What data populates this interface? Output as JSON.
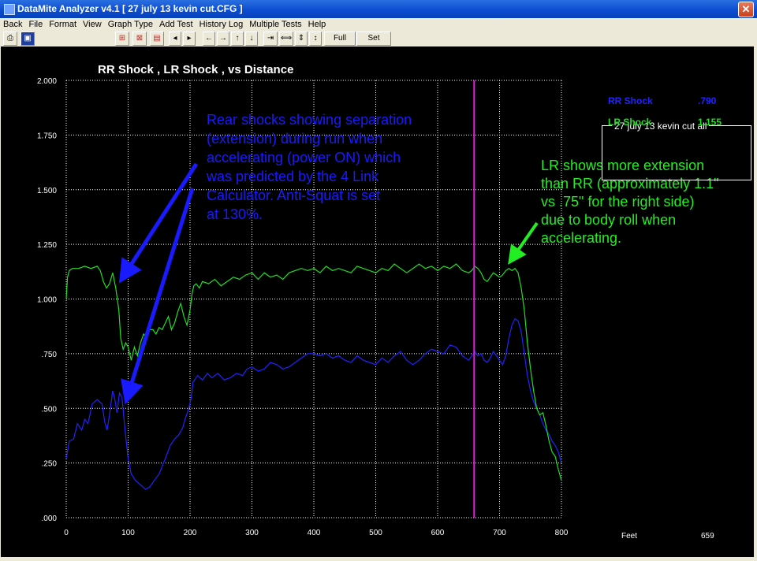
{
  "window": {
    "title": "DataMite Analyzer v4.1  [ 27 july 13 kevin cut.CFG ]",
    "close_glyph": "✕"
  },
  "menu": [
    "Back",
    "File",
    "Format",
    "View",
    "Graph Type",
    "Add Test",
    "History Log",
    "Multiple Tests",
    "Help"
  ],
  "toolbar": {
    "full_view_label": "Full View",
    "set_scales_label": "Set Scales"
  },
  "legend": {
    "title": "27 july 13 kevin cut   all",
    "items": [
      {
        "name": "RR Shock",
        "value": ".790",
        "color": "#2222ff"
      },
      {
        "name": "LR Shock",
        "value": "1.155",
        "color": "#22dd22"
      }
    ]
  },
  "cursor_readout": {
    "label": "Feet",
    "value": "659"
  },
  "chart_data": {
    "type": "line",
    "title": "RR Shock , LR Shock ,  vs Distance",
    "xlabel": "",
    "ylabel": "",
    "xlim": [
      0,
      800
    ],
    "ylim": [
      0,
      2.0
    ],
    "x_ticks": [
      "0",
      "100",
      "200",
      "300",
      "400",
      "500",
      "600",
      "700",
      "800"
    ],
    "y_ticks": [
      ".000",
      ".250",
      ".500",
      ".750",
      "1.000",
      "1.250",
      "1.500",
      "1.750",
      "2.000"
    ],
    "grid": true,
    "cursor_x": 659,
    "cursor_color": "#e020e0",
    "series": [
      {
        "name": "RR Shock",
        "color": "#2222ff",
        "points": [
          [
            0,
            0.27
          ],
          [
            5,
            0.35
          ],
          [
            12,
            0.36
          ],
          [
            18,
            0.43
          ],
          [
            25,
            0.4
          ],
          [
            30,
            0.45
          ],
          [
            35,
            0.43
          ],
          [
            42,
            0.52
          ],
          [
            50,
            0.54
          ],
          [
            58,
            0.52
          ],
          [
            62,
            0.44
          ],
          [
            66,
            0.4
          ],
          [
            70,
            0.47
          ],
          [
            75,
            0.58
          ],
          [
            78,
            0.55
          ],
          [
            82,
            0.48
          ],
          [
            86,
            0.57
          ],
          [
            90,
            0.55
          ],
          [
            95,
            0.4
          ],
          [
            100,
            0.27
          ],
          [
            105,
            0.2
          ],
          [
            112,
            0.17
          ],
          [
            120,
            0.15
          ],
          [
            128,
            0.13
          ],
          [
            135,
            0.14
          ],
          [
            142,
            0.17
          ],
          [
            150,
            0.2
          ],
          [
            160,
            0.27
          ],
          [
            168,
            0.33
          ],
          [
            175,
            0.36
          ],
          [
            182,
            0.38
          ],
          [
            188,
            0.41
          ],
          [
            192,
            0.45
          ],
          [
            198,
            0.5
          ],
          [
            202,
            0.55
          ],
          [
            205,
            0.62
          ],
          [
            212,
            0.65
          ],
          [
            220,
            0.63
          ],
          [
            228,
            0.66
          ],
          [
            235,
            0.64
          ],
          [
            245,
            0.66
          ],
          [
            255,
            0.63
          ],
          [
            265,
            0.64
          ],
          [
            275,
            0.66
          ],
          [
            285,
            0.65
          ],
          [
            292,
            0.68
          ],
          [
            300,
            0.69
          ],
          [
            310,
            0.67
          ],
          [
            320,
            0.68
          ],
          [
            330,
            0.71
          ],
          [
            340,
            0.7
          ],
          [
            350,
            0.68
          ],
          [
            360,
            0.69
          ],
          [
            370,
            0.71
          ],
          [
            380,
            0.73
          ],
          [
            390,
            0.75
          ],
          [
            400,
            0.75
          ],
          [
            410,
            0.74
          ],
          [
            420,
            0.75
          ],
          [
            430,
            0.73
          ],
          [
            440,
            0.74
          ],
          [
            450,
            0.72
          ],
          [
            460,
            0.71
          ],
          [
            470,
            0.74
          ],
          [
            480,
            0.72
          ],
          [
            490,
            0.71
          ],
          [
            500,
            0.7
          ],
          [
            510,
            0.73
          ],
          [
            520,
            0.71
          ],
          [
            530,
            0.74
          ],
          [
            540,
            0.76
          ],
          [
            550,
            0.72
          ],
          [
            560,
            0.7
          ],
          [
            570,
            0.72
          ],
          [
            580,
            0.75
          ],
          [
            590,
            0.77
          ],
          [
            600,
            0.76
          ],
          [
            610,
            0.75
          ],
          [
            620,
            0.79
          ],
          [
            630,
            0.78
          ],
          [
            640,
            0.74
          ],
          [
            650,
            0.72
          ],
          [
            655,
            0.74
          ],
          [
            660,
            0.76
          ],
          [
            665,
            0.74
          ],
          [
            670,
            0.75
          ],
          [
            675,
            0.72
          ],
          [
            680,
            0.71
          ],
          [
            685,
            0.73
          ],
          [
            690,
            0.76
          ],
          [
            695,
            0.74
          ],
          [
            700,
            0.72
          ],
          [
            705,
            0.7
          ],
          [
            710,
            0.74
          ],
          [
            715,
            0.82
          ],
          [
            720,
            0.88
          ],
          [
            725,
            0.91
          ],
          [
            730,
            0.9
          ],
          [
            735,
            0.85
          ],
          [
            740,
            0.75
          ],
          [
            745,
            0.65
          ],
          [
            750,
            0.58
          ],
          [
            755,
            0.53
          ],
          [
            760,
            0.5
          ],
          [
            765,
            0.47
          ],
          [
            770,
            0.43
          ],
          [
            775,
            0.4
          ],
          [
            780,
            0.38
          ],
          [
            785,
            0.35
          ],
          [
            790,
            0.33
          ],
          [
            795,
            0.3
          ],
          [
            800,
            0.25
          ]
        ]
      },
      {
        "name": "LR Shock",
        "color": "#22dd22",
        "points": [
          [
            0,
            1.0
          ],
          [
            2,
            1.1
          ],
          [
            5,
            1.13
          ],
          [
            10,
            1.14
          ],
          [
            20,
            1.14
          ],
          [
            30,
            1.15
          ],
          [
            40,
            1.14
          ],
          [
            50,
            1.15
          ],
          [
            55,
            1.13
          ],
          [
            60,
            1.08
          ],
          [
            65,
            1.05
          ],
          [
            70,
            1.07
          ],
          [
            75,
            1.12
          ],
          [
            80,
            1.05
          ],
          [
            85,
            0.95
          ],
          [
            88,
            0.82
          ],
          [
            92,
            0.77
          ],
          [
            96,
            0.8
          ],
          [
            100,
            0.78
          ],
          [
            105,
            0.72
          ],
          [
            110,
            0.78
          ],
          [
            115,
            0.74
          ],
          [
            120,
            0.8
          ],
          [
            125,
            0.84
          ],
          [
            130,
            0.82
          ],
          [
            135,
            0.86
          ],
          [
            140,
            0.86
          ],
          [
            145,
            0.84
          ],
          [
            150,
            0.87
          ],
          [
            155,
            0.86
          ],
          [
            160,
            0.89
          ],
          [
            165,
            0.92
          ],
          [
            170,
            0.86
          ],
          [
            175,
            0.89
          ],
          [
            180,
            0.94
          ],
          [
            185,
            0.98
          ],
          [
            190,
            0.92
          ],
          [
            195,
            0.88
          ],
          [
            200,
            0.95
          ],
          [
            203,
            1.02
          ],
          [
            206,
            1.06
          ],
          [
            210,
            1.07
          ],
          [
            215,
            1.05
          ],
          [
            220,
            1.08
          ],
          [
            230,
            1.07
          ],
          [
            240,
            1.09
          ],
          [
            250,
            1.06
          ],
          [
            260,
            1.08
          ],
          [
            270,
            1.1
          ],
          [
            280,
            1.09
          ],
          [
            290,
            1.11
          ],
          [
            300,
            1.12
          ],
          [
            310,
            1.09
          ],
          [
            320,
            1.12
          ],
          [
            330,
            1.1
          ],
          [
            340,
            1.11
          ],
          [
            350,
            1.09
          ],
          [
            360,
            1.12
          ],
          [
            370,
            1.13
          ],
          [
            380,
            1.14
          ],
          [
            390,
            1.13
          ],
          [
            400,
            1.14
          ],
          [
            410,
            1.12
          ],
          [
            420,
            1.15
          ],
          [
            430,
            1.13
          ],
          [
            440,
            1.14
          ],
          [
            450,
            1.13
          ],
          [
            460,
            1.12
          ],
          [
            470,
            1.15
          ],
          [
            480,
            1.14
          ],
          [
            490,
            1.13
          ],
          [
            500,
            1.12
          ],
          [
            510,
            1.14
          ],
          [
            520,
            1.13
          ],
          [
            530,
            1.16
          ],
          [
            540,
            1.14
          ],
          [
            550,
            1.12
          ],
          [
            560,
            1.14
          ],
          [
            570,
            1.16
          ],
          [
            580,
            1.14
          ],
          [
            590,
            1.15
          ],
          [
            600,
            1.13
          ],
          [
            610,
            1.15
          ],
          [
            620,
            1.14
          ],
          [
            630,
            1.16
          ],
          [
            640,
            1.13
          ],
          [
            650,
            1.12
          ],
          [
            655,
            1.13
          ],
          [
            660,
            1.15
          ],
          [
            665,
            1.14
          ],
          [
            670,
            1.12
          ],
          [
            675,
            1.09
          ],
          [
            680,
            1.08
          ],
          [
            685,
            1.1
          ],
          [
            690,
            1.12
          ],
          [
            695,
            1.11
          ],
          [
            700,
            1.1
          ],
          [
            705,
            1.11
          ],
          [
            710,
            1.13
          ],
          [
            715,
            1.14
          ],
          [
            720,
            1.13
          ],
          [
            725,
            1.14
          ],
          [
            730,
            1.12
          ],
          [
            735,
            1.05
          ],
          [
            740,
            0.95
          ],
          [
            745,
            0.8
          ],
          [
            750,
            0.68
          ],
          [
            755,
            0.58
          ],
          [
            760,
            0.5
          ],
          [
            765,
            0.47
          ],
          [
            770,
            0.48
          ],
          [
            775,
            0.42
          ],
          [
            780,
            0.35
          ],
          [
            785,
            0.3
          ],
          [
            790,
            0.28
          ],
          [
            795,
            0.22
          ],
          [
            800,
            0.17
          ]
        ]
      }
    ],
    "annotations": [
      {
        "text": "Rear shocks showing separation (extension) during run when accelerating (power ON) which was predicted by the 4 Link Calculator.  Anti-Squat is set at 130%.",
        "color": "#1a1aff"
      },
      {
        "text": "LR shows more extension than RR (approximately 1.1\" vs .75\" for the right side) due to body roll when accelerating.",
        "color": "#22ee22"
      }
    ],
    "annotation_lines": [
      "Rear shocks showing separation",
      "(extension) during run when",
      "accelerating (power ON) which",
      "was predicted by the 4 Link",
      "Calculator.  Anti-Squat is set",
      "at 130%."
    ],
    "annotation2_lines": [
      "LR shows more extension",
      "than RR (approximately 1.1\"",
      "vs .75\" for the right side)",
      "due to body roll when",
      "accelerating."
    ]
  }
}
